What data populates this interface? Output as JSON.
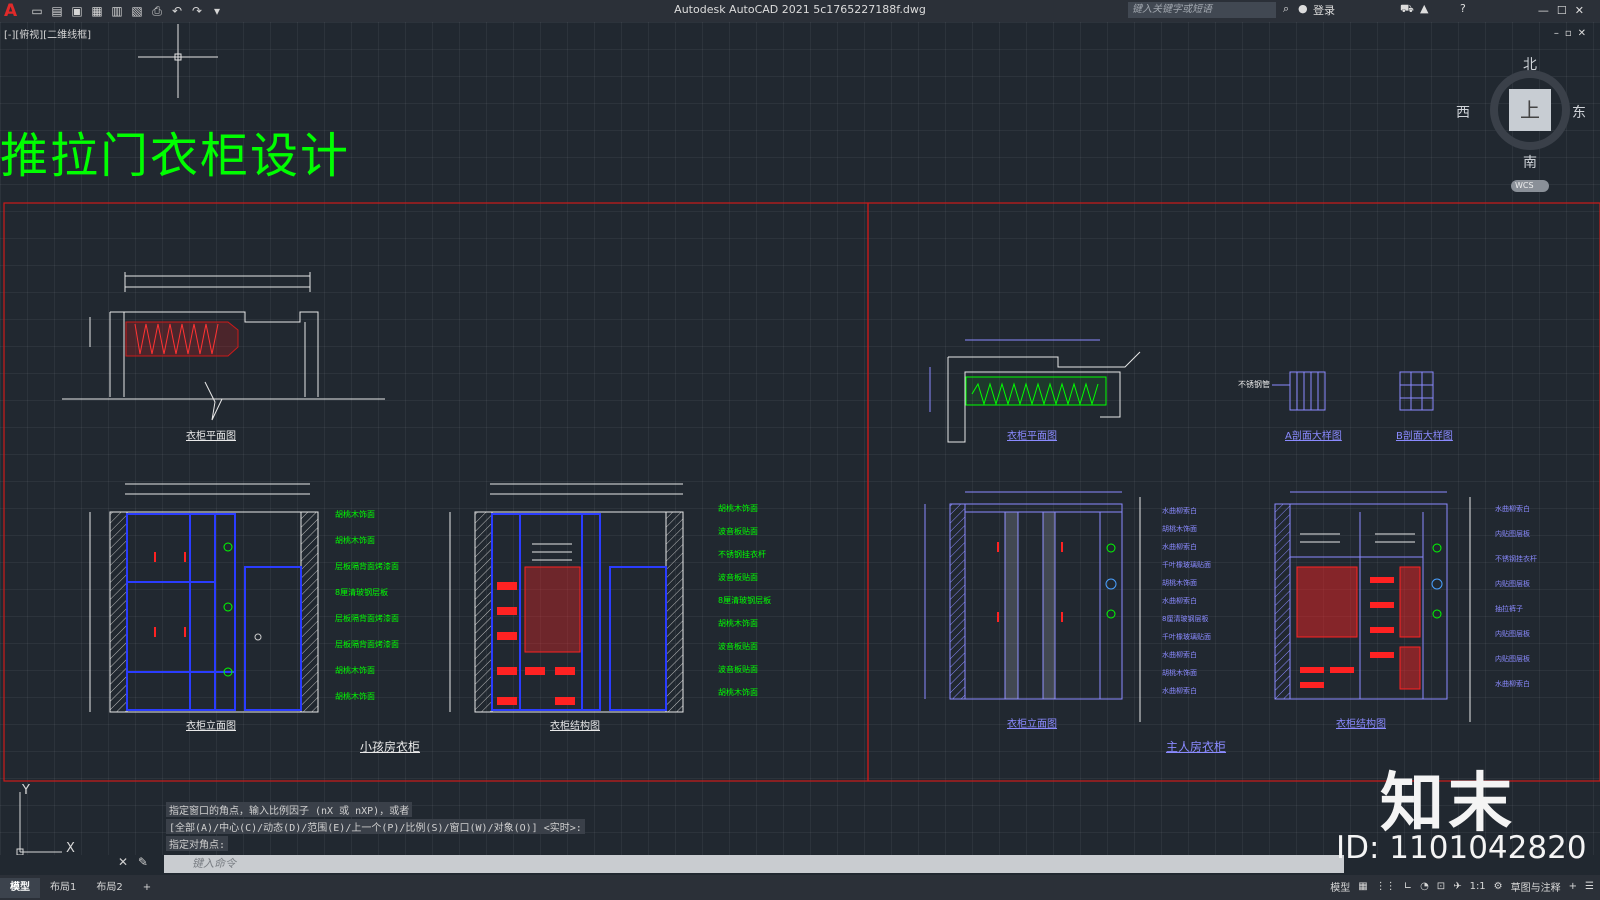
{
  "app": {
    "logo": "A",
    "title": "Autodesk AutoCAD 2021    5c1765227188f.dwg",
    "search_placeholder": "键入关键字或短语",
    "login": "登录",
    "view_label": "[-][俯视][二维线框]"
  },
  "drawing": {
    "main_title": "推拉门衣柜设计",
    "left_group_title": "小孩房衣柜",
    "right_group_title": "主人房衣柜",
    "left_captions": [
      "衣柜平面图",
      "衣柜立面图",
      "衣柜结构图"
    ],
    "right_captions": [
      "衣柜平面图",
      "A剖面大样图",
      "B剖面大样图",
      "衣柜立面图",
      "衣柜结构图"
    ],
    "small_label": "不锈钢管",
    "left_annot_a": [
      "胡桃木饰面",
      "胡桃木饰面",
      "层板隔背面烤漆面",
      "8厘清玻钢层板",
      "层板隔背面烤漆面",
      "层板隔背面烤漆面",
      "胡桃木饰面",
      "胡桃木饰面"
    ],
    "left_annot_b": [
      "胡桃木饰面",
      "波音板贴面",
      "不锈钢挂衣杆",
      "波音板贴面",
      "8厘清玻钢层板",
      "胡桃木饰面",
      "波音板贴面",
      "波音板贴面",
      "胡桃木饰面"
    ],
    "right_annot_a": [
      "水曲柳索白",
      "胡桃木饰面",
      "水曲柳索白",
      "千叶橡玻璃贴面",
      "胡桃木饰面",
      "水曲柳索白",
      "8厘清玻钢层板",
      "千叶橡玻璃贴面",
      "水曲柳索白",
      "胡桃木饰面",
      "水曲柳索白"
    ],
    "right_annot_b": [
      "水曲柳索白",
      "内贴图层板",
      "不锈钢挂衣杆",
      "内贴图层板",
      "抽拉裤子",
      "内贴图层板",
      "内贴图层板",
      "水曲柳索白"
    ]
  },
  "compass": {
    "north": "北",
    "south": "南",
    "east": "东",
    "west": "西",
    "face": "上",
    "wcs": "WCS"
  },
  "command": {
    "line1": "指定窗口的角点，输入比例因子 (nX 或 nXP)，或者",
    "line2": "[全部(A)/中心(C)/动态(D)/范围(E)/上一个(P)/比例(S)/窗口(W)/对象(O)] <实时>:",
    "line3": "指定对角点:",
    "input_placeholder": "键入命令"
  },
  "tabs": [
    "模型",
    "布局1",
    "布局2"
  ],
  "status": {
    "model": "模型",
    "scale": "1:1",
    "workspace": "草图与注释"
  },
  "watermark": {
    "brand": "知末",
    "id": "ID: 1101042820"
  },
  "colors": {
    "accent_green": "#00ff00",
    "frame_red": "#cc1a1a",
    "line_blue": "#3a5cff"
  }
}
